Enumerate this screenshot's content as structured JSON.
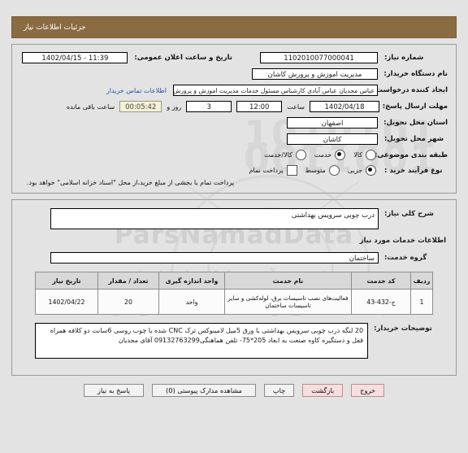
{
  "header": {
    "title": "جزئیات اطلاعات نیاز"
  },
  "need_info": {
    "need_number_label": "شماره نیاز:",
    "need_number": "1102010077000041",
    "announce_date_label": "تاریخ و ساعت اعلان عمومی:",
    "announce_date": "1402/04/15 - 11:39",
    "buyer_org_label": "نام دستگاه خریدار:",
    "buyer_org": "مدیریت اموزش و پرورش کاشان",
    "creator_label": "ایجاد کننده درخواست:",
    "creator": "عباس مجدیان عباس آبادی کارشناس مسئول خدمات مدیریت اموزش و پرورش ک",
    "contact_link": "اطلاعات تماس خریدار",
    "deadline_label": "مهلت ارسال پاسخ: تا تاریخ:",
    "deadline_date": "1402/04/18",
    "hour_label": "ساعت",
    "deadline_time": "12:00",
    "days_value": "3",
    "days_label": "روز و",
    "countdown": "00:05:42",
    "countdown_label": "ساعت باقی مانده",
    "province_label": "استان محل تحویل:",
    "province": "اصفهان",
    "city_label": "شهر محل تحویل:",
    "city": "کاشان",
    "category_label": "طبقه بندی موضوعی:",
    "category_options": [
      {
        "label": "کالا",
        "selected": false
      },
      {
        "label": "خدمت",
        "selected": true
      },
      {
        "label": "کالا/خدمت",
        "selected": false
      }
    ],
    "purchase_type_label": "نوع فرآیند خرید :",
    "purchase_type_options": [
      {
        "label": "جزیی",
        "selected": true
      },
      {
        "label": "متوسط",
        "selected": false
      }
    ],
    "payment_checkbox_label": "پرداخت نمام",
    "payment_note": "پرداخت تمام یا بخشی از مبلغ خرید،از محل \"اسناد خزانه اسلامی\" خواهد بود."
  },
  "description": {
    "general_label": "شرح کلی نیاز:",
    "general_value": "درب چوبی سرویس بهداشتی",
    "services_section_title": "اطلاعات خدمات مورد نیاز",
    "service_group_label": "گروه خدمت:",
    "service_group_value": "ساختمان"
  },
  "table": {
    "columns": [
      "ردیف",
      "کد خدمت",
      "نام خدمت",
      "واحد اندازه گیری",
      "تعداد / مقدار",
      "تاریخ نیاز"
    ],
    "rows": [
      {
        "index": "1",
        "code": "ج-432-43",
        "name": "فعالیت‌های نصب تاسیسات برق، لوله‌کشی و سایر تاسیسات ساختمان",
        "unit": "واحد",
        "quantity": "20",
        "date": "1402/04/22"
      }
    ]
  },
  "buyer_notes": {
    "label": "توضیحات خریدار:",
    "value": "20 لنگه درب چوبی سرویس بهداشتی با ورق 5میل لامینوکس ترک CNC شده با چوب روسی 6سانت دو کلافه همراه قفل و دستگیره کاوه صنعت به ابعاد 205*75- تلفن هماهنگی09132763299 آقای مجدیان"
  },
  "buttons": [
    {
      "name": "respond",
      "label": "پاسخ به نیاز",
      "style": "default"
    },
    {
      "name": "view-attachments",
      "label": "مشاهده مدارک پیوستی (0)",
      "style": "default"
    },
    {
      "name": "print",
      "label": "چاپ",
      "style": "default"
    },
    {
      "name": "back",
      "label": "بازگشت",
      "style": "pink"
    },
    {
      "name": "exit",
      "label": "خروج",
      "style": "pink"
    }
  ],
  "watermark": {
    "brand": "ParsNamadData",
    "digits_line1": "1010101",
    "digits_line2": "0011001",
    "fa_line1": "مرکز فر آوری اطلاعات ایران",
    "fa_line2": "پایگاه اطلاع رسانی مناقصه و مزایده",
    "fa_line3": "اطلاعات مناقصات و مزایدات ایران"
  },
  "colors": {
    "header_brown": "#8a6b42",
    "link_blue": "#2b4fa8",
    "pink_button": "#f6dede",
    "timer_bg": "#f5f2d9",
    "page_bg": "#e3e3e3"
  }
}
